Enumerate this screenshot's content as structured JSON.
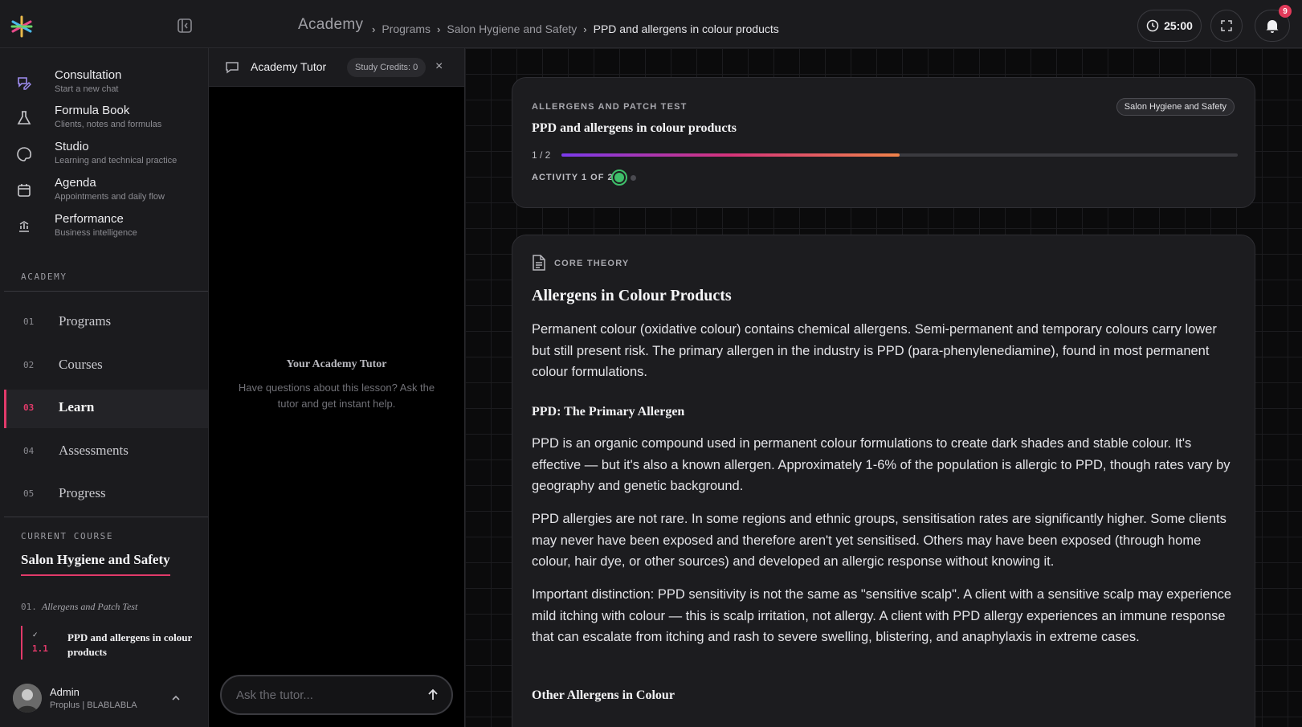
{
  "header": {
    "brand": "Academy",
    "breadcrumbs": [
      "Programs",
      "Salon Hygiene and Safety",
      "PPD and allergens in colour products"
    ],
    "timer": "25:00",
    "notifications_count": "9"
  },
  "sidebar": {
    "nav": [
      {
        "title": "Consultation",
        "subtitle": "Start a new chat",
        "icon": "chat-pen-icon"
      },
      {
        "title": "Formula Book",
        "subtitle": "Clients, notes and formulas",
        "icon": "flask-icon"
      },
      {
        "title": "Studio",
        "subtitle": "Learning and technical practice",
        "icon": "palette-icon"
      },
      {
        "title": "Agenda",
        "subtitle": "Appointments and daily flow",
        "icon": "calendar-icon"
      },
      {
        "title": "Performance",
        "subtitle": "Business intelligence",
        "icon": "chart-icon"
      }
    ],
    "academy_label": "ACADEMY",
    "academy_items": [
      {
        "num": "01",
        "label": "Programs"
      },
      {
        "num": "02",
        "label": "Courses"
      },
      {
        "num": "03",
        "label": "Learn"
      },
      {
        "num": "04",
        "label": "Assessments"
      },
      {
        "num": "05",
        "label": "Progress"
      }
    ],
    "current_course_label": "CURRENT COURSE",
    "current_course": "Salon Hygiene and Safety",
    "module": {
      "num": "01.",
      "title": "Allergens and Patch Test"
    },
    "lesson": {
      "check": "✓",
      "num": "1.1",
      "title": "PPD and allergens in colour products"
    },
    "user": {
      "name": "Admin",
      "subtitle": "Proplus | BLABLABLA"
    }
  },
  "tutor": {
    "title": "Academy Tutor",
    "credits": "Study Credits: 0",
    "close": "×",
    "empty_title": "Your Academy Tutor",
    "empty_subtitle": "Have questions about this lesson? Ask the tutor and get instant help.",
    "input_placeholder": "Ask the tutor..."
  },
  "lesson_card": {
    "kicker": "ALLERGENS AND PATCH TEST",
    "tag": "Salon Hygiene and Safety",
    "title": "PPD and allergens in colour products",
    "progress_label": "1 / 2",
    "progress_fraction": 0.5,
    "activity_label": "ACTIVITY 1 OF 2"
  },
  "content": {
    "kicker": "CORE THEORY",
    "heading": "Allergens in Colour Products",
    "intro": "Permanent colour (oxidative colour) contains chemical allergens. Semi-permanent and temporary colours carry lower but still present risk. The primary allergen in the industry is PPD (para-phenylenediamine), found in most permanent colour formulations.",
    "sub1": "PPD: The Primary Allergen",
    "p1": "PPD is an organic compound used in permanent colour formulations to create dark shades and stable colour. It's effective — but it's also a known allergen. Approximately 1-6% of the population is allergic to PPD, though rates vary by geography and genetic background.",
    "p2": "PPD allergies are not rare. In some regions and ethnic groups, sensitisation rates are significantly higher. Some clients may never have been exposed and therefore aren't yet sensitised. Others may have been exposed (through home colour, hair dye, or other sources) and developed an allergic response without knowing it.",
    "p3": "Important distinction: PPD sensitivity is not the same as \"sensitive scalp\". A client with a sensitive scalp may experience mild itching with colour — this is scalp irritation, not allergy. A client with PPD allergy experiences an immune response that can escalate from itching and rash to severe swelling, blistering, and anaphylaxis in extreme cases.",
    "sub2": "Other Allergens in Colour"
  },
  "colors": {
    "accent": "#e23a6a",
    "success": "#3fbf6a",
    "progress_start": "#7b3aed",
    "progress_end": "#f0834a"
  }
}
